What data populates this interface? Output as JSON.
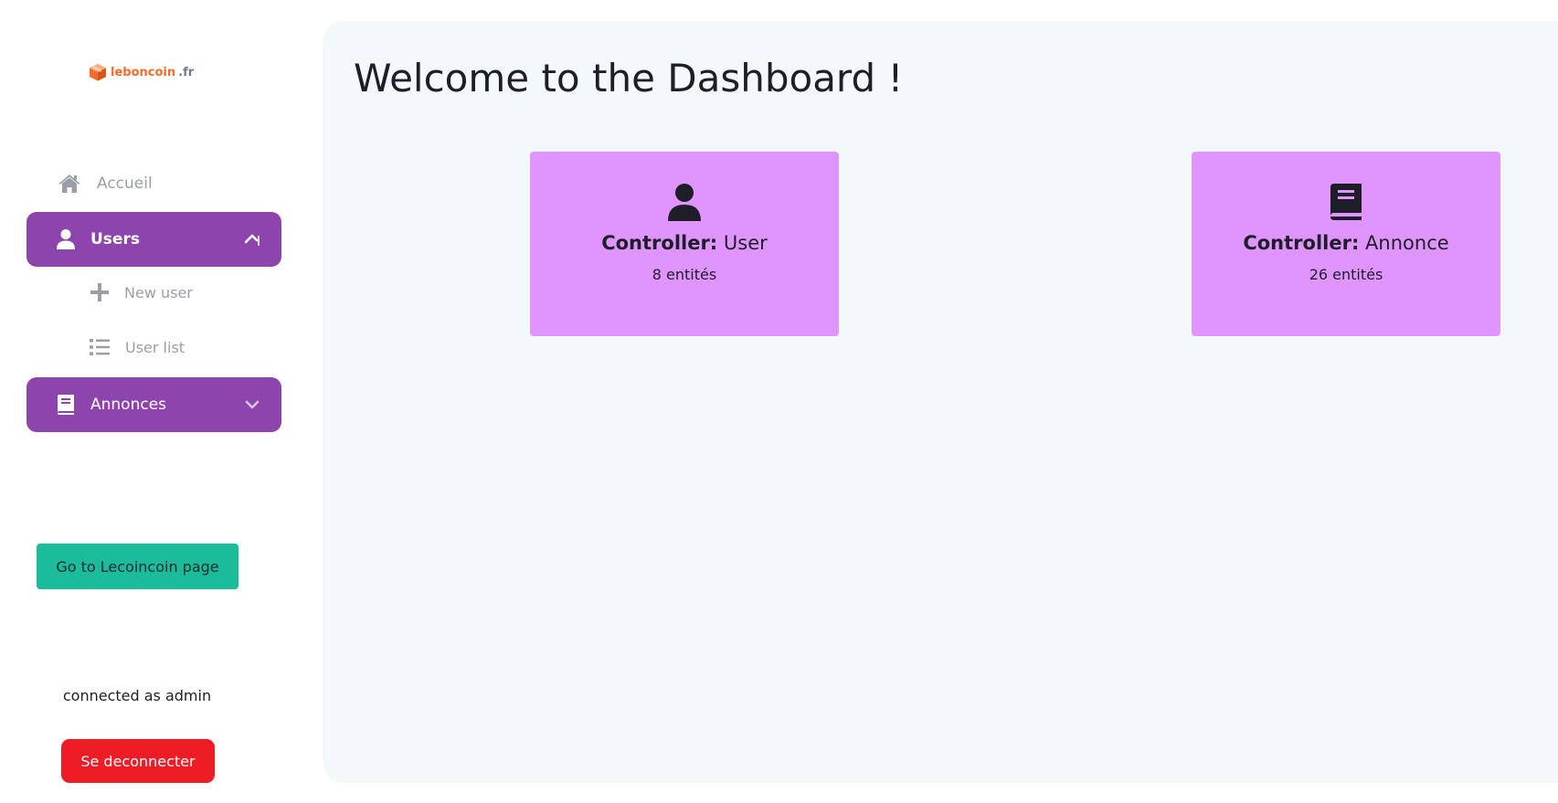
{
  "logo": {
    "main": "leboncoin",
    "tld": ".fr"
  },
  "sidebar": {
    "home": {
      "label": "Accueil",
      "icon": "home-icon"
    },
    "users": {
      "label": "Users",
      "icon": "user-icon",
      "subitems": [
        {
          "label": "New user",
          "icon": "plus-icon"
        },
        {
          "label": "User list",
          "icon": "list-icon"
        }
      ]
    },
    "annonces": {
      "label": "Annonces",
      "icon": "book-icon"
    },
    "go_button": "Go to Lecoincoin page",
    "connected": "connected as admin",
    "logout_button": "Se deconnecter"
  },
  "main": {
    "title": "Welcome to the Dashboard !",
    "cards": [
      {
        "controller_label": "Controller:",
        "controller_name": "User",
        "count": "8 entités",
        "icon": "user-icon"
      },
      {
        "controller_label": "Controller:",
        "controller_name": "Annonce",
        "count": "26 entités",
        "icon": "book-icon"
      }
    ]
  },
  "colors": {
    "sidebar_active": "#8e44ad",
    "card_bg": "#df95fd",
    "main_bg": "#f3f8fb",
    "go_button": "#1abc9c",
    "logout_button": "#ee1c25",
    "logo_orange": "#f56b2a"
  }
}
